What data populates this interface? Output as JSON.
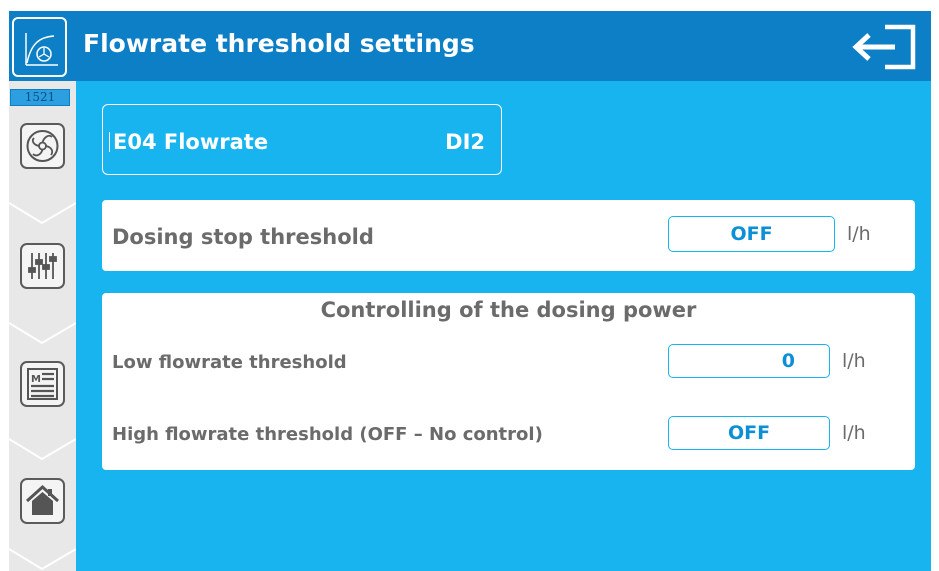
{
  "header": {
    "title": "Flowrate threshold settings",
    "app_icon": "flowrate-gauge-icon",
    "exit_icon": "exit-arrow-icon"
  },
  "sidebar": {
    "counter": "1521",
    "buttons": [
      {
        "icon": "pump-fan-icon"
      },
      {
        "icon": "sliders-icon"
      },
      {
        "icon": "menu-icon"
      },
      {
        "icon": "home-icon"
      }
    ]
  },
  "input": {
    "name": "E04 Flowrate",
    "channel": "DI2"
  },
  "dosing_stop": {
    "label": "Dosing stop threshold",
    "value": "OFF",
    "unit": "l/h"
  },
  "dosing_power": {
    "heading": "Controlling of the dosing power",
    "low": {
      "label": "Low flowrate threshold",
      "value": "0",
      "unit": "l/h"
    },
    "high": {
      "label": "High flowrate threshold (OFF – No control)",
      "value": "OFF",
      "unit": "l/h"
    }
  },
  "colors": {
    "header": "#0c7fc6",
    "panel": "#18b4f0",
    "accent": "#0c8fd6",
    "label": "#6b6b6b"
  }
}
